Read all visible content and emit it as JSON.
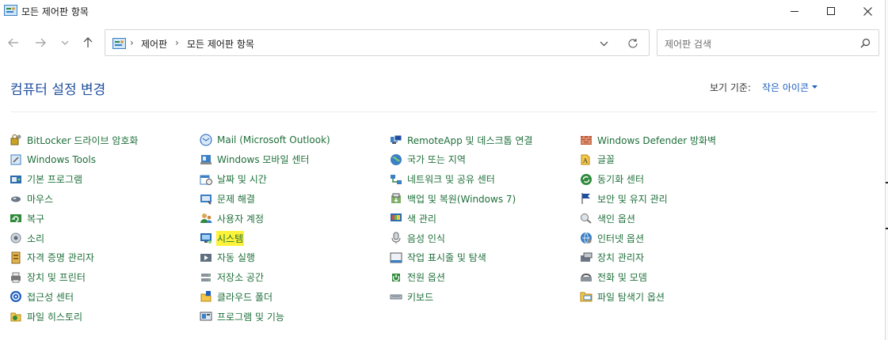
{
  "window": {
    "title": "모든 제어판 항목"
  },
  "address": {
    "crumbs": [
      "제어판",
      "모든 제어판 항목"
    ]
  },
  "search": {
    "placeholder": "제어판 검색"
  },
  "header": {
    "title": "컴퓨터 설정 변경",
    "view_label": "보기 기준:",
    "view_value": "작은 아이콘"
  },
  "colors": {
    "link": "#1f6f3a",
    "title": "#1f4e9d",
    "highlight": "#fdf23a"
  },
  "columns": [
    {
      "items": [
        {
          "label": "BitLocker 드라이브 암호화",
          "icon": "bitlocker-icon"
        },
        {
          "label": "Windows Tools",
          "icon": "windows-tools-icon"
        },
        {
          "label": "기본 프로그램",
          "icon": "default-programs-icon"
        },
        {
          "label": "마우스",
          "icon": "mouse-icon"
        },
        {
          "label": "복구",
          "icon": "recovery-icon"
        },
        {
          "label": "소리",
          "icon": "sound-icon"
        },
        {
          "label": "자격 증명 관리자",
          "icon": "credential-manager-icon"
        },
        {
          "label": "장치 및 프린터",
          "icon": "devices-printers-icon"
        },
        {
          "label": "접근성 센터",
          "icon": "ease-of-access-icon"
        },
        {
          "label": "파일 히스토리",
          "icon": "file-history-icon"
        }
      ]
    },
    {
      "items": [
        {
          "label": "Mail (Microsoft Outlook)",
          "icon": "mail-icon"
        },
        {
          "label": "Windows 모바일 센터",
          "icon": "mobility-center-icon"
        },
        {
          "label": "날짜 및 시간",
          "icon": "date-time-icon"
        },
        {
          "label": "문제 해결",
          "icon": "troubleshooting-icon"
        },
        {
          "label": "사용자 계정",
          "icon": "user-accounts-icon"
        },
        {
          "label": "시스템",
          "icon": "system-icon",
          "highlighted": true
        },
        {
          "label": "자동 실행",
          "icon": "autoplay-icon"
        },
        {
          "label": "저장소 공간",
          "icon": "storage-spaces-icon"
        },
        {
          "label": "클라우드 폴더",
          "icon": "cloud-folder-icon"
        },
        {
          "label": "프로그램 및 기능",
          "icon": "programs-features-icon"
        }
      ]
    },
    {
      "items": [
        {
          "label": "RemoteApp 및 데스크톱 연결",
          "icon": "remoteapp-icon"
        },
        {
          "label": "국가 또는 지역",
          "icon": "region-icon"
        },
        {
          "label": "네트워크 및 공유 센터",
          "icon": "network-icon"
        },
        {
          "label": "백업 및 복원(Windows 7)",
          "icon": "backup-icon"
        },
        {
          "label": "색 관리",
          "icon": "color-management-icon"
        },
        {
          "label": "음성 인식",
          "icon": "speech-icon"
        },
        {
          "label": "작업 표시줄 및 탐색",
          "icon": "taskbar-icon"
        },
        {
          "label": "전원 옵션",
          "icon": "power-icon"
        },
        {
          "label": "키보드",
          "icon": "keyboard-icon"
        }
      ]
    },
    {
      "items": [
        {
          "label": "Windows Defender 방화벽",
          "icon": "firewall-icon"
        },
        {
          "label": "글꼴",
          "icon": "fonts-icon"
        },
        {
          "label": "동기화 센터",
          "icon": "sync-center-icon"
        },
        {
          "label": "보안 및 유지 관리",
          "icon": "security-maintenance-icon"
        },
        {
          "label": "색인 옵션",
          "icon": "indexing-icon"
        },
        {
          "label": "인터넷 옵션",
          "icon": "internet-options-icon"
        },
        {
          "label": "장치 관리자",
          "icon": "device-manager-icon"
        },
        {
          "label": "전화 및 모뎀",
          "icon": "phone-modem-icon"
        },
        {
          "label": "파일 탐색기 옵션",
          "icon": "explorer-options-icon"
        }
      ]
    }
  ]
}
